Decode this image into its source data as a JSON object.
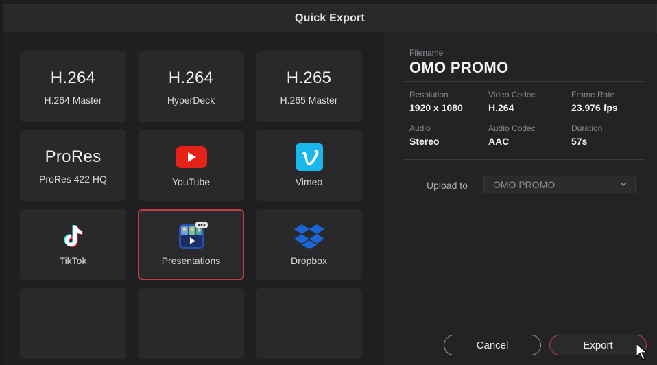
{
  "dialog": {
    "title": "Quick Export"
  },
  "presets": [
    {
      "big": "H.264",
      "label": "H.264 Master"
    },
    {
      "big": "H.264",
      "label": "HyperDeck"
    },
    {
      "big": "H.265",
      "label": "H.265 Master"
    },
    {
      "big": "ProRes",
      "label": "ProRes 422 HQ"
    },
    {
      "icon": "youtube-icon",
      "label": "YouTube"
    },
    {
      "icon": "vimeo-icon",
      "label": "Vimeo"
    },
    {
      "icon": "tiktok-icon",
      "label": "TikTok"
    },
    {
      "icon": "presentations-icon",
      "label": "Presentations",
      "selected": true
    },
    {
      "icon": "dropbox-icon",
      "label": "Dropbox"
    }
  ],
  "details": {
    "filename_label": "Filename",
    "filename": "OMO PROMO",
    "resolution_label": "Resolution",
    "resolution": "1920 x 1080",
    "video_codec_label": "Video Codec",
    "video_codec": "H.264",
    "frame_rate_label": "Frame Rate",
    "frame_rate": "23.976 fps",
    "audio_label": "Audio",
    "audio": "Stereo",
    "audio_codec_label": "Audio Codec",
    "audio_codec": "AAC",
    "duration_label": "Duration",
    "duration": "57s"
  },
  "upload": {
    "label": "Upload to",
    "selected": "OMO PROMO"
  },
  "actions": {
    "cancel": "Cancel",
    "export": "Export"
  },
  "colors": {
    "accent": "#c23a44",
    "youtube": "#e62117",
    "vimeo": "#1ab7ea",
    "dropbox": "#1a66d6",
    "tiktok_cyan": "#25f4ee",
    "tiktok_red": "#fe2c55"
  }
}
